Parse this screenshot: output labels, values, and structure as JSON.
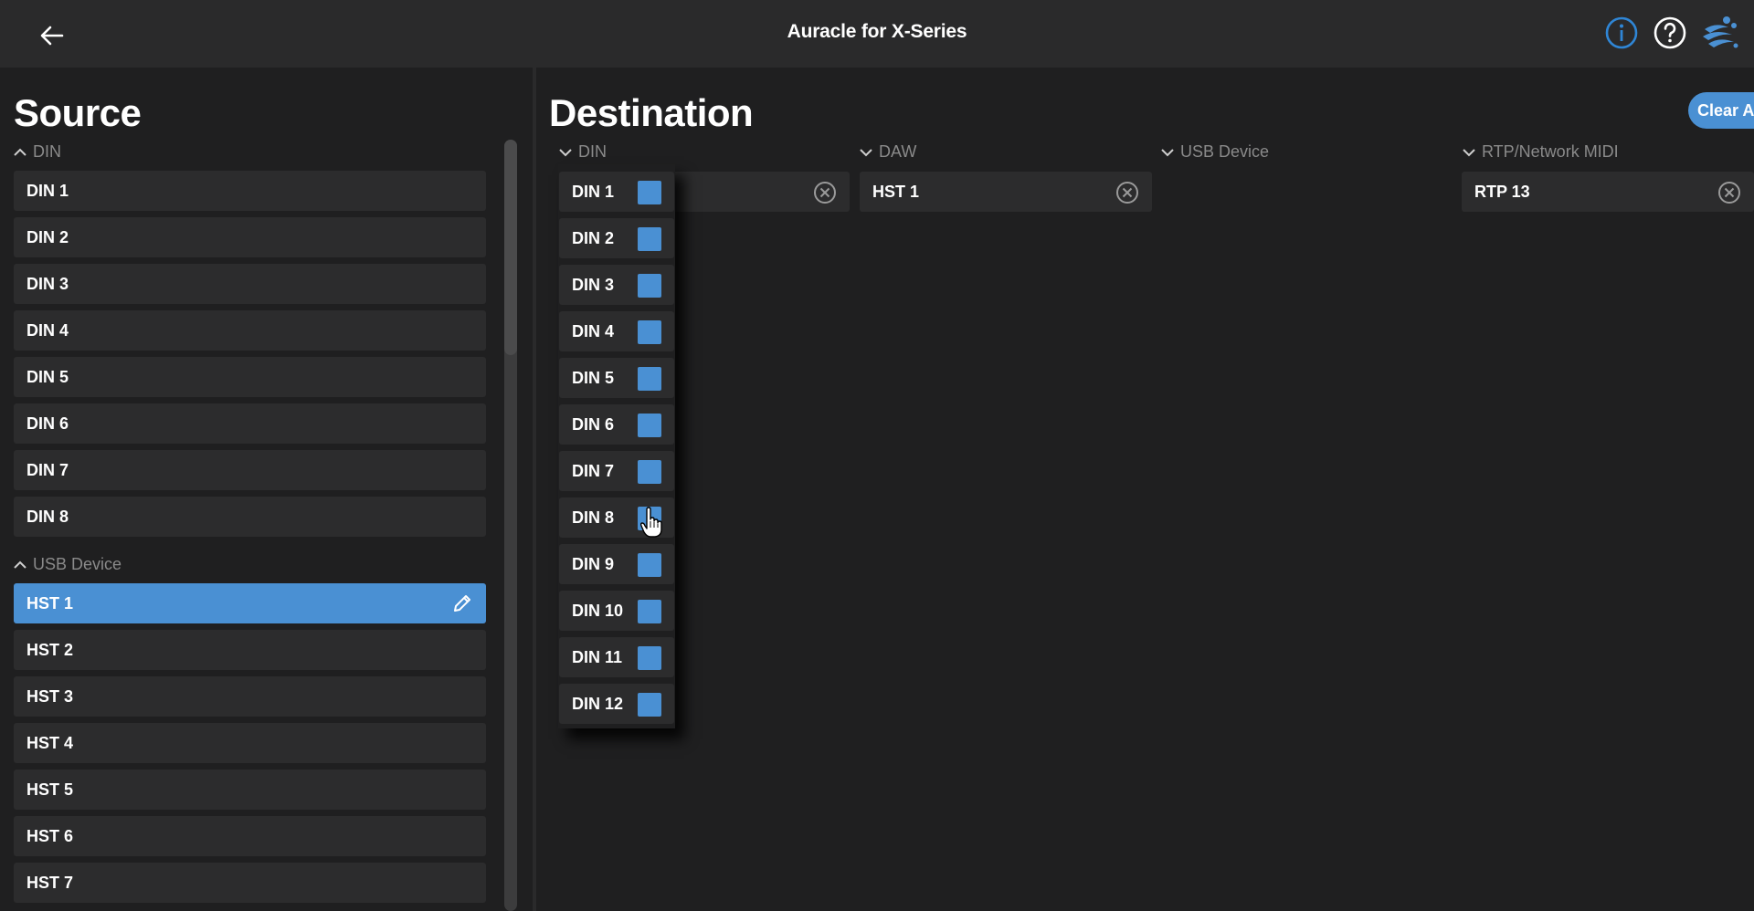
{
  "app": {
    "title": "Auracle for X-Series"
  },
  "header": {
    "icons": [
      "back-arrow-icon",
      "info-icon",
      "help-icon",
      "brand-logo-icon"
    ]
  },
  "colors": {
    "accent": "#4a90d3",
    "background": "#1f1f20",
    "topbar": "#2a2a2b",
    "item": "#2c2c2d",
    "muted": "#8a8a8a"
  },
  "source": {
    "title": "Source",
    "groups": [
      {
        "label": "DIN",
        "items": [
          "DIN 1",
          "DIN 2",
          "DIN 3",
          "DIN 4",
          "DIN 5",
          "DIN 6",
          "DIN 7",
          "DIN 8"
        ]
      },
      {
        "label": "USB Device",
        "items": [
          "HST 1",
          "HST 2",
          "HST 3",
          "HST 4",
          "HST 5",
          "HST 6",
          "HST 7"
        ],
        "selected": "HST 1"
      }
    ]
  },
  "destination": {
    "title": "Destination",
    "clear_all_label": "Clear All",
    "columns": [
      {
        "label": "DIN",
        "items": [
          ""
        ]
      },
      {
        "label": "DAW",
        "items": [
          "HST 1"
        ]
      },
      {
        "label": "USB Device",
        "items": []
      },
      {
        "label": "RTP/Network MIDI",
        "items": [
          "RTP 13"
        ]
      }
    ]
  },
  "dropdown": {
    "items": [
      "DIN 1",
      "DIN 2",
      "DIN 3",
      "DIN 4",
      "DIN 5",
      "DIN 6",
      "DIN 7",
      "DIN 8",
      "DIN 9",
      "DIN 10",
      "DIN 11",
      "DIN 12"
    ]
  }
}
